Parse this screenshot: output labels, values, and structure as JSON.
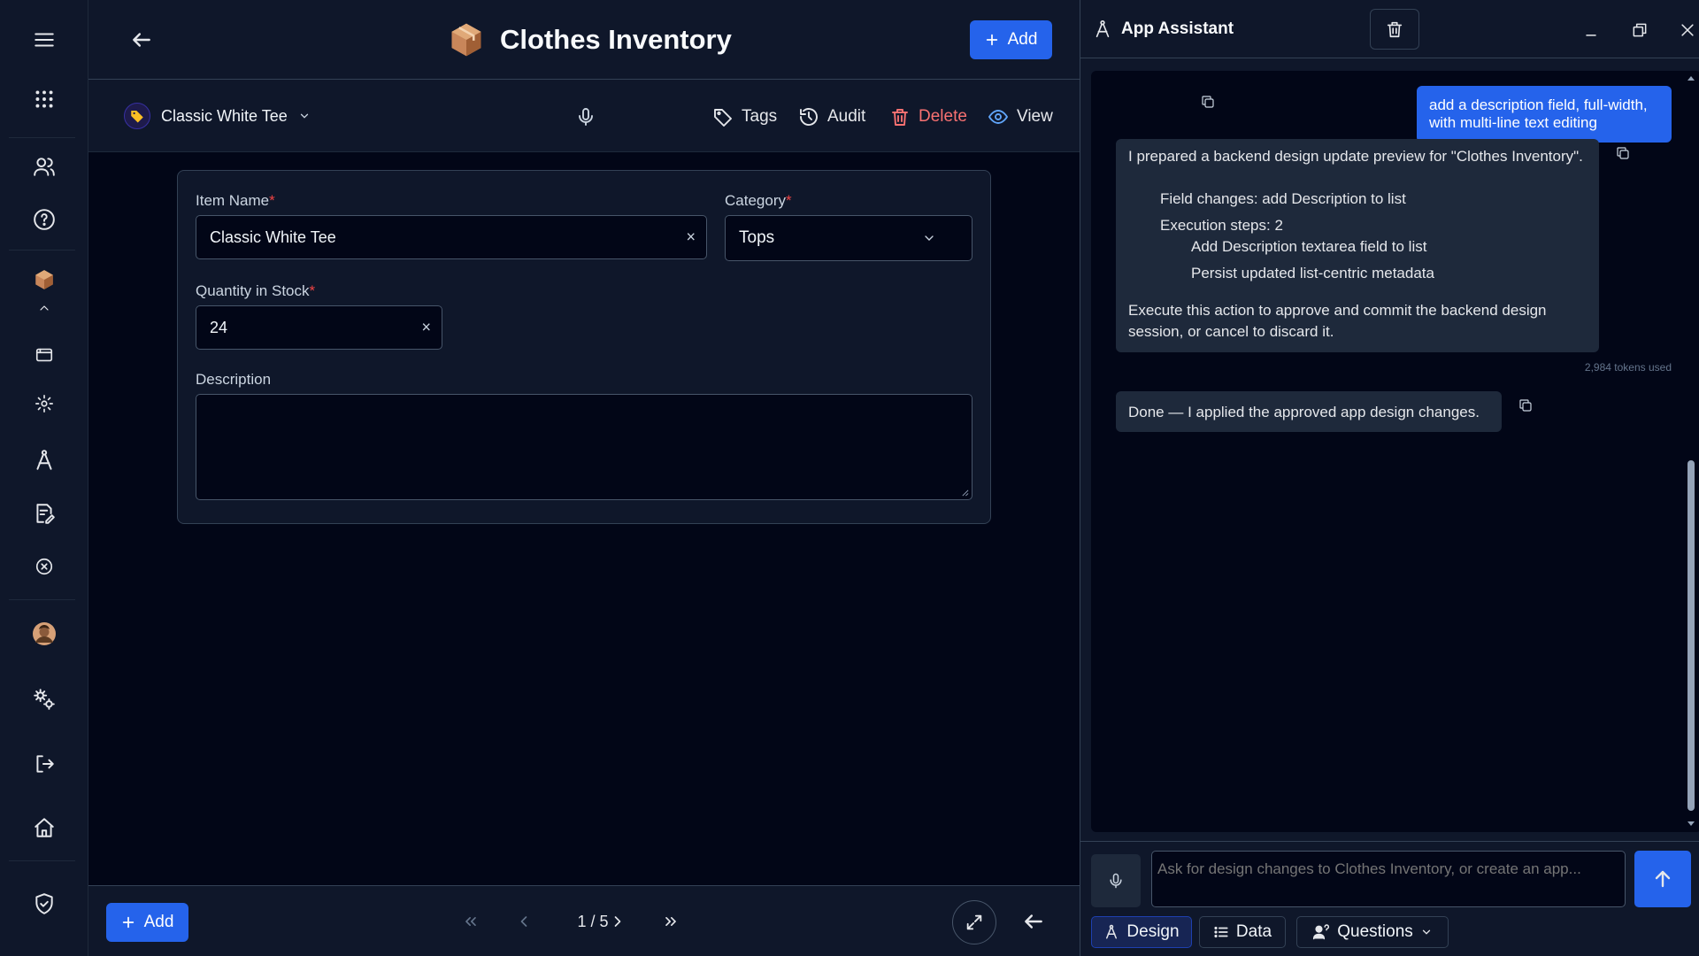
{
  "app": {
    "title": "Clothes Inventory",
    "add_label": "Add"
  },
  "toolbar": {
    "record": "Classic White Tee",
    "tags": "Tags",
    "audit": "Audit",
    "delete": "Delete",
    "view": "View"
  },
  "form": {
    "item_name": {
      "label": "Item Name",
      "required": "*",
      "value": "Classic White Tee"
    },
    "category": {
      "label": "Category",
      "required": "*",
      "value": "Tops"
    },
    "quantity": {
      "label": "Quantity in Stock",
      "required": "*",
      "value": "24"
    },
    "description": {
      "label": "Description",
      "value": ""
    },
    "clear_glyph": "×"
  },
  "footer": {
    "add_label": "Add",
    "page": "1 / 5"
  },
  "assistant": {
    "title": "App Assistant",
    "messages": {
      "user": "add a description field, full-width, with multi-line text editing",
      "bot_intro": "I prepared a backend design update preview for \"Clothes Inventory\".",
      "field_changes": "Field changes: add Description to list",
      "execution_steps": "Execution steps: 2",
      "step1": "Add Description textarea field to list",
      "step2": "Persist updated list-centric metadata",
      "bot_outro": "Execute this action to approve and commit the backend design session, or cancel to discard it.",
      "tokens": "2,984 tokens used",
      "done": "Done — I applied the approved app design changes."
    },
    "input_placeholder": "Ask for design changes to Clothes Inventory, or create an app...",
    "tabs": {
      "design": "Design",
      "data": "Data",
      "questions": "Questions"
    }
  },
  "colors": {
    "accent": "#2563eb",
    "danger": "#f87171",
    "required": "#ef4444",
    "view": "#60a5fa"
  }
}
